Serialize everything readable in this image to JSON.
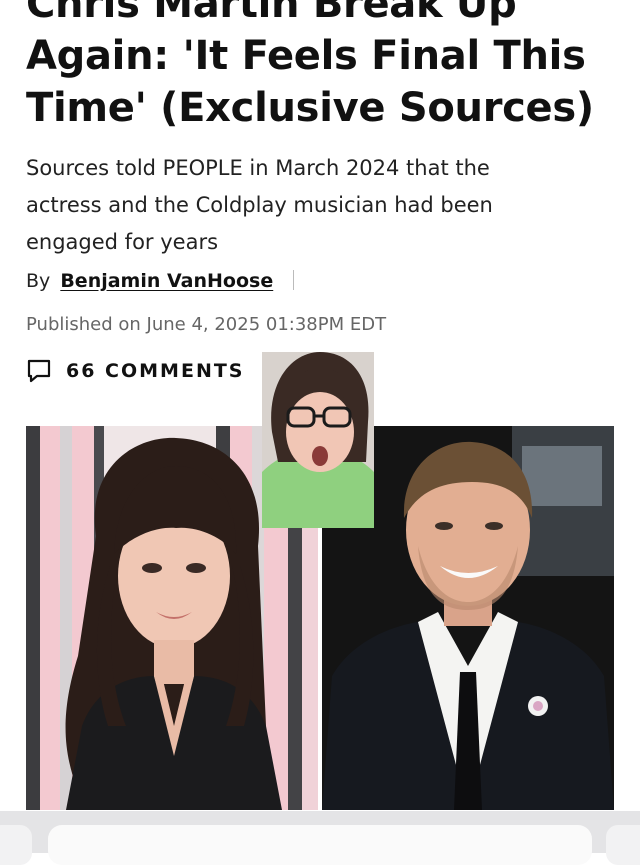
{
  "article": {
    "headline_lines": [
      "Chris Martin Break Up",
      "Again: 'It Feels Final This",
      "Time' (Exclusive Sources)"
    ],
    "dek_lines": [
      "Sources told PEOPLE in March 2024 that the",
      "actress and the Coldplay musician had been",
      "engaged for years"
    ],
    "byline_prefix": "By",
    "author": "Benjamin VanHoose",
    "published": "Published on June 4, 2025 01:38PM EDT",
    "comments_label": "66 COMMENTS"
  },
  "icons": {
    "comments": "speech-bubble-icon"
  },
  "colors": {
    "text": "#111111",
    "muted": "#666666",
    "toolbar": "#e4e4e6"
  }
}
